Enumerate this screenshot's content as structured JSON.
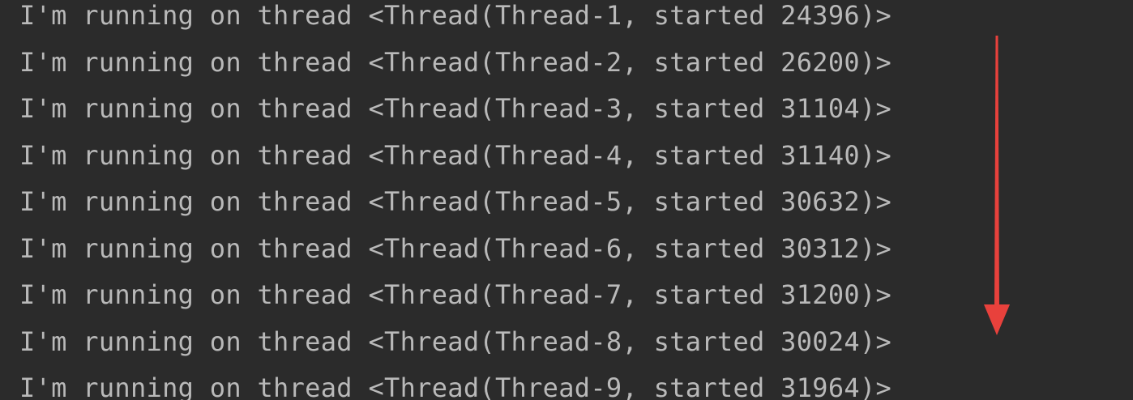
{
  "console": {
    "lines": [
      "I'm running on thread <Thread(Thread-1, started 24396)>",
      "I'm running on thread <Thread(Thread-2, started 26200)>",
      "I'm running on thread <Thread(Thread-3, started 31104)>",
      "I'm running on thread <Thread(Thread-4, started 31140)>",
      "I'm running on thread <Thread(Thread-5, started 30632)>",
      "I'm running on thread <Thread(Thread-6, started 30312)>",
      "I'm running on thread <Thread(Thread-7, started 31200)>",
      "I'm running on thread <Thread(Thread-8, started 30024)>",
      "I'm running on thread <Thread(Thread-9, started 31964)>"
    ]
  },
  "annotation": {
    "arrow_direction": "down",
    "arrow_color": "#e8413c"
  },
  "colors": {
    "background": "#2b2b2b",
    "text": "#b9b9b9"
  }
}
